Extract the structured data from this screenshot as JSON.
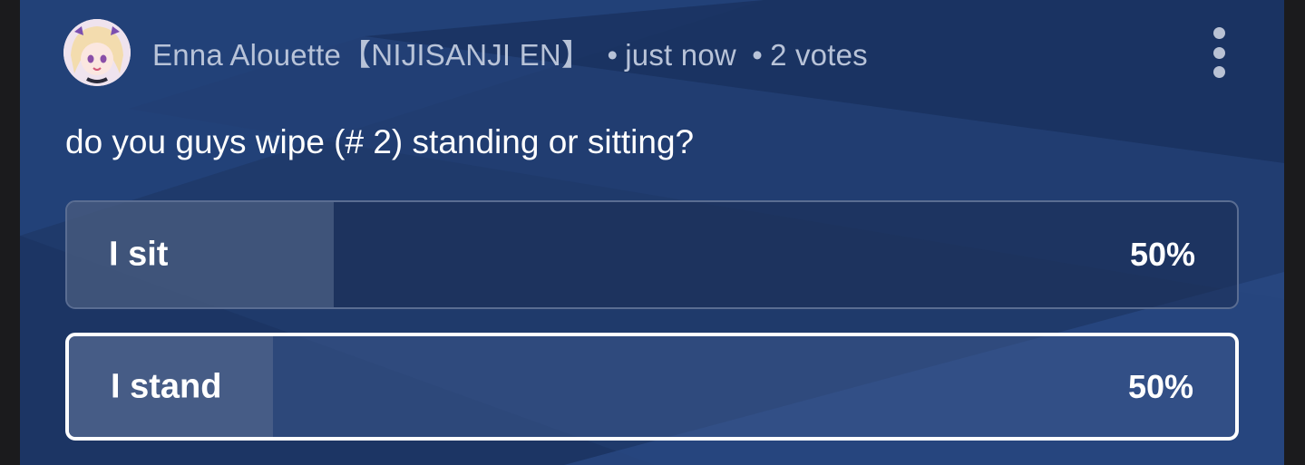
{
  "post": {
    "author": "Enna Alouette【NIJISANJI EN】",
    "separator": "•",
    "time": "just now",
    "votes": "2 votes",
    "question": "do you guys wipe (# 2) standing or sitting?"
  },
  "options": [
    {
      "label": "I sit",
      "percent_text": "50%",
      "share": 0.5,
      "selected": false
    },
    {
      "label": "I stand",
      "percent_text": "50%",
      "share": 0.5,
      "selected": true
    }
  ],
  "icons": {
    "avatar": "author-avatar",
    "menu": "more-vert-icon"
  },
  "colors": {
    "card_background": "#1f3a6b",
    "muted_text": "#b8c3d8",
    "text": "#ffffff",
    "selected_border": "#ffffff"
  }
}
